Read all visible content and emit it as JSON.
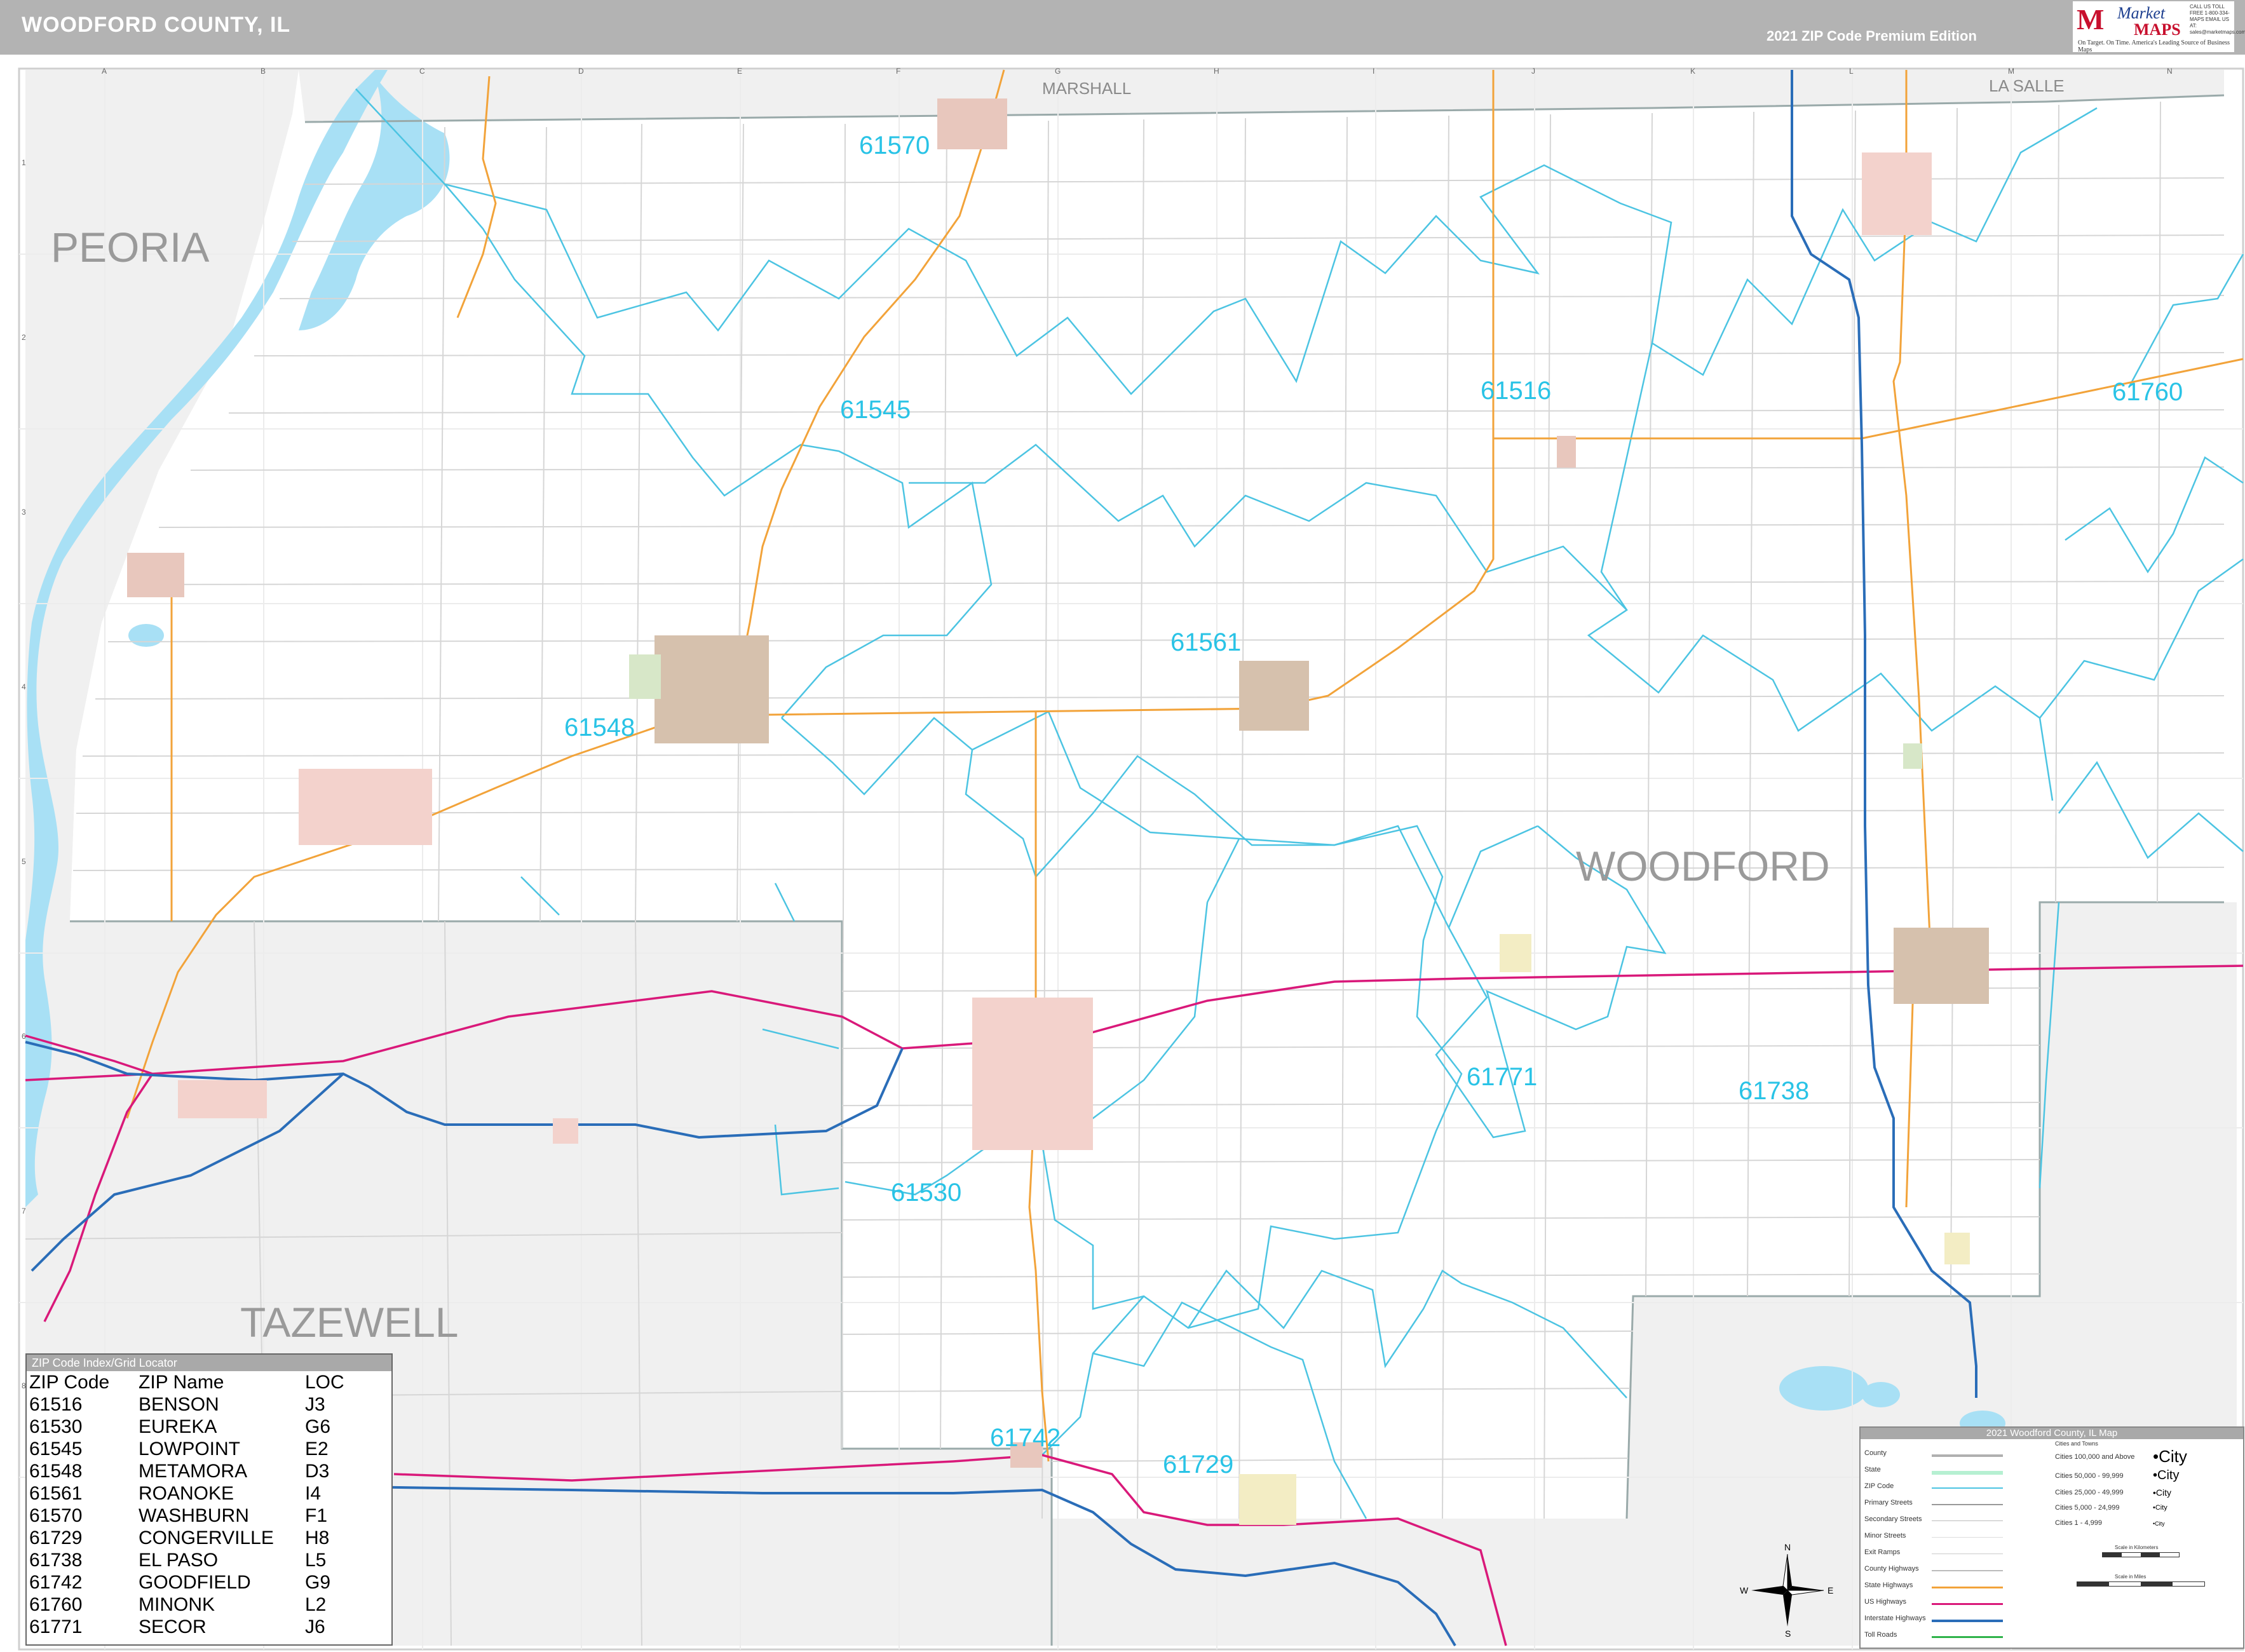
{
  "header": {
    "title": "WOODFORD COUNTY, IL",
    "edition": "2021 ZIP Code Premium Edition"
  },
  "logo": {
    "brand_top": "Market",
    "brand_bottom": "MAPS",
    "tagline": "On Target. On Time. America's Leading Source of Business Maps",
    "contact": "CALL US TOLL FREE 1-800-334-MAPS EMAIL US AT: sales@marketmaps.com"
  },
  "map": {
    "counties": {
      "peoria": "PEORIA",
      "tazewell": "TAZEWELL",
      "woodford": "WOODFORD",
      "marshall": "MARSHALL",
      "la_salle": "LA SALLE"
    },
    "zip_labels": [
      "61570",
      "61545",
      "61516",
      "61760",
      "61561",
      "61548",
      "61771",
      "61738",
      "61530",
      "61742",
      "61729"
    ],
    "grid_columns": [
      "A",
      "B",
      "C",
      "D",
      "E",
      "F",
      "G",
      "H",
      "I",
      "J",
      "K",
      "L",
      "M",
      "N"
    ],
    "grid_rows": [
      "1",
      "2",
      "3",
      "4",
      "5",
      "6",
      "7",
      "8"
    ],
    "colors": {
      "water": "#a8e0f5",
      "outside": "#f0f0f0",
      "zip_boundary": "#4cc4e2",
      "zip_label": "#29c3e6",
      "state_highway": "#f2a33a",
      "us_highway": "#d9197a",
      "interstate": "#2a6db8",
      "city_fill": "#e8c7bd",
      "county_line": "#9aaaaa"
    }
  },
  "index_table": {
    "title": "ZIP Code Index/Grid Locator",
    "headers": [
      "ZIP Code",
      "ZIP Name",
      "LOC"
    ],
    "rows": [
      [
        "61516",
        "BENSON",
        "J3"
      ],
      [
        "61530",
        "EUREKA",
        "G6"
      ],
      [
        "61545",
        "LOWPOINT",
        "E2"
      ],
      [
        "61548",
        "METAMORA",
        "D3"
      ],
      [
        "61561",
        "ROANOKE",
        "I4"
      ],
      [
        "61570",
        "WASHBURN",
        "F1"
      ],
      [
        "61729",
        "CONGERVILLE",
        "H8"
      ],
      [
        "61738",
        "EL PASO",
        "L5"
      ],
      [
        "61742",
        "GOODFIELD",
        "G9"
      ],
      [
        "61760",
        "MINONK",
        "L2"
      ],
      [
        "61771",
        "SECOR",
        "J6"
      ]
    ]
  },
  "legend": {
    "title": "2021 Woodford County, IL Map",
    "items": [
      "County",
      "State",
      "ZIP Code",
      "Primary Streets",
      "Secondary Streets",
      "Minor Streets",
      "Exit Ramps",
      "County Highways",
      "State Highways",
      "US Highways",
      "Interstate Highways",
      "Toll Roads"
    ],
    "cities_header": "Cities and Towns",
    "cities": [
      {
        "range": "Cities 100,000 and Above",
        "sample": "•City"
      },
      {
        "range": "Cities 50,000 - 99,999",
        "sample": "•City"
      },
      {
        "range": "Cities 25,000 - 49,999",
        "sample": "•City"
      },
      {
        "range": "Cities 5,000 - 24,999",
        "sample": "•City"
      },
      {
        "range": "Cities 1 - 4,999",
        "sample": "•City"
      }
    ],
    "scale_km": "Scale in Kilometers",
    "scale_mi": "Scale in Miles"
  },
  "compass": {
    "n": "N",
    "s": "S",
    "e": "E",
    "w": "W"
  }
}
